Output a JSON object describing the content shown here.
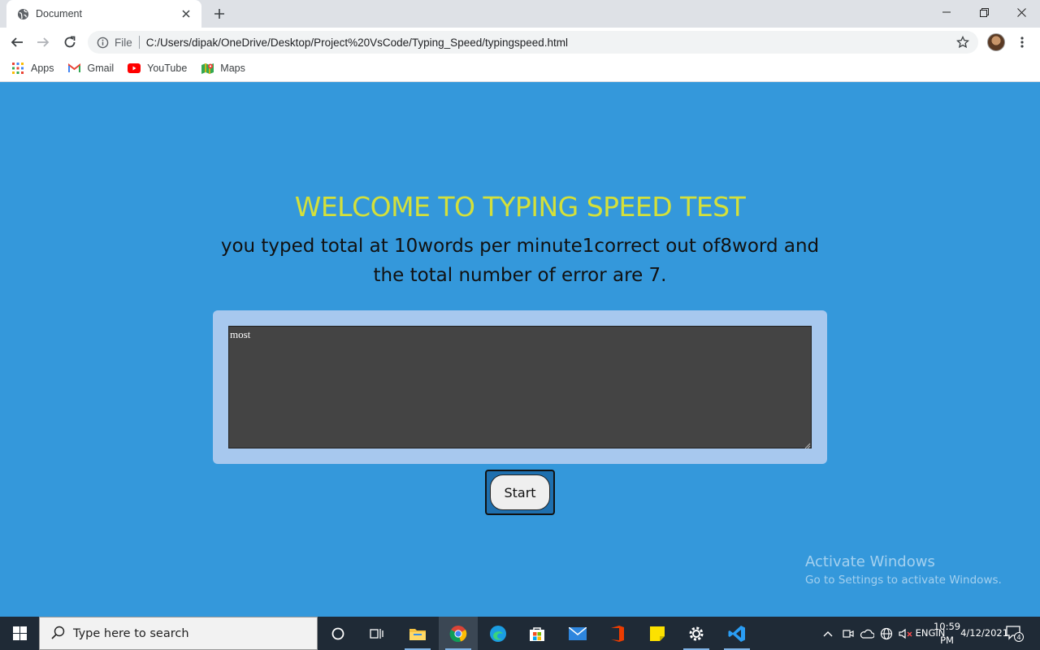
{
  "browser": {
    "tab_title": "Document",
    "scheme_label": "File",
    "url": "C:/Users/dipak/OneDrive/Desktop/Project%20VsCode/Typing_Speed/typingspeed.html",
    "bookmarks": [
      {
        "label": "Apps",
        "icon": "apps-grid-icon"
      },
      {
        "label": "Gmail",
        "icon": "gmail-icon"
      },
      {
        "label": "YouTube",
        "icon": "youtube-icon"
      },
      {
        "label": "Maps",
        "icon": "maps-icon"
      }
    ]
  },
  "page": {
    "heading": "WELCOME TO TYPING SPEED TEST",
    "result_text": "you typed total at 10words per minute1correct out of8word and the total number of error are 7.",
    "textarea_value": "most",
    "start_label": "Start"
  },
  "watermark": {
    "title": "Activate Windows",
    "subtitle": "Go to Settings to activate Windows."
  },
  "taskbar": {
    "search_placeholder": "Type here to search",
    "lang_top": "ENG",
    "lang_bottom": "IN",
    "time": "10:59 PM",
    "date": "4/12/2021",
    "notification_count": "4"
  },
  "colors": {
    "page_background": "#3498db",
    "heading": "#d4e03a",
    "panel": "#a7c8ee",
    "textarea": "#444444"
  }
}
